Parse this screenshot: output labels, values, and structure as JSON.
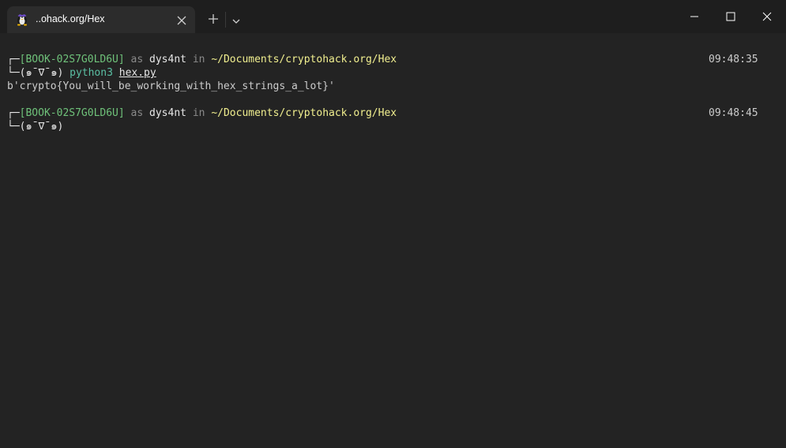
{
  "tab": {
    "title": "..ohack.org/Hex",
    "icon": "linux-penguin-icon",
    "close_icon": "close-icon"
  },
  "tabbar": {
    "new_tab_icon": "plus-icon",
    "dropdown_icon": "chevron-down-icon"
  },
  "window_controls": [
    "minimize-icon",
    "maximize-icon",
    "close-icon"
  ],
  "terminal": {
    "prompts": [
      {
        "corner": "┌─",
        "host": "[BOOK-02S7G0LD6U]",
        "as": "as",
        "user": "dys4nt",
        "in": "in",
        "path": "~/Documents/cryptohack.org/Hex",
        "time": "09:48:35",
        "face_prefix": "└─",
        "face": "(๑¯∇¯๑)",
        "command": "python3",
        "arg": "hex.py"
      },
      {
        "corner": "┌─",
        "host": "[BOOK-02S7G0LD6U]",
        "as": "as",
        "user": "dys4nt",
        "in": "in",
        "path": "~/Documents/cryptohack.org/Hex",
        "time": "09:48:45",
        "face_prefix": "└─",
        "face": "(๑¯∇¯๑)"
      }
    ],
    "output": "b'crypto{You_will_be_working_with_hex_strings_a_lot}'"
  },
  "colors": {
    "background": "#232323",
    "titlebar": "#1e1e1e",
    "host": "#6fc27a",
    "path": "#f1ef8f",
    "command": "#5bc0a4",
    "muted": "#8a8a8a"
  }
}
